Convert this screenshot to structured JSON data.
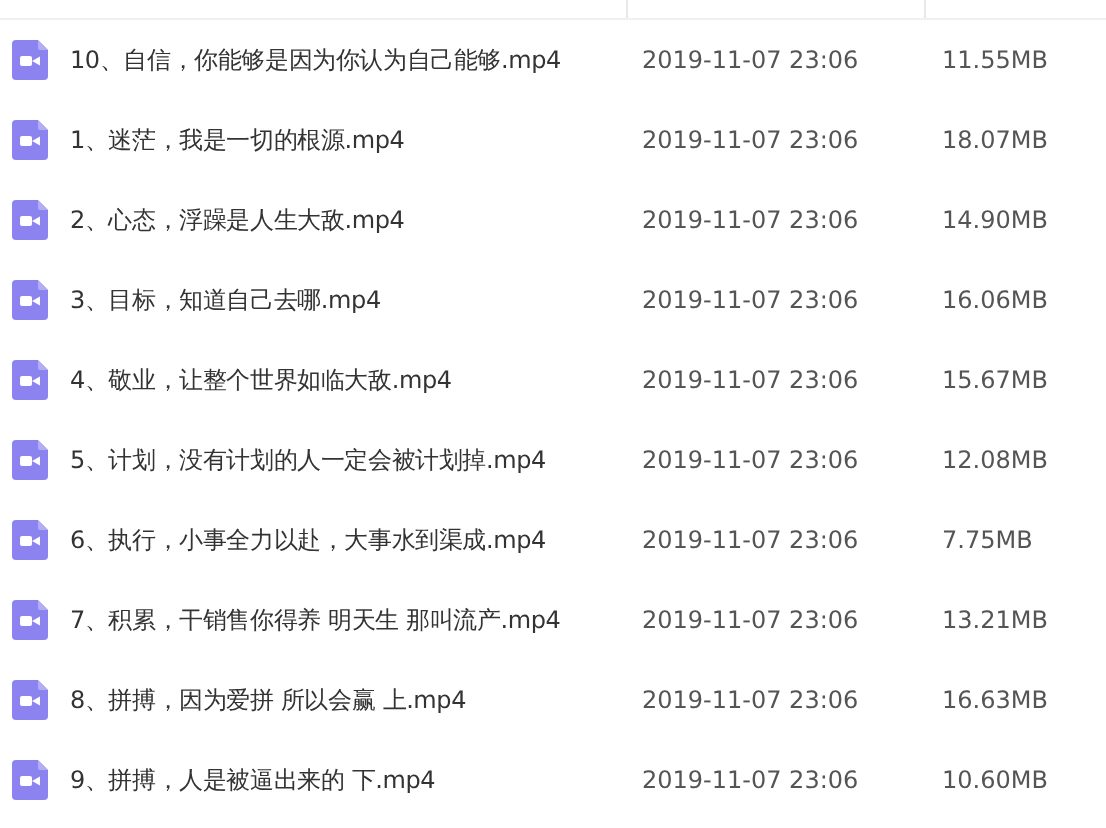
{
  "files": [
    {
      "name": "10、自信，你能够是因为你认为自己能够.mp4",
      "modified": "2019-11-07 23:06",
      "size": "11.55MB"
    },
    {
      "name": "1、迷茫，我是一切的根源.mp4",
      "modified": "2019-11-07 23:06",
      "size": "18.07MB"
    },
    {
      "name": "2、心态，浮躁是人生大敌.mp4",
      "modified": "2019-11-07 23:06",
      "size": "14.90MB"
    },
    {
      "name": "3、目标，知道自己去哪.mp4",
      "modified": "2019-11-07 23:06",
      "size": "16.06MB"
    },
    {
      "name": "4、敬业，让整个世界如临大敌.mp4",
      "modified": "2019-11-07 23:06",
      "size": "15.67MB"
    },
    {
      "name": "5、计划，没有计划的人一定会被计划掉.mp4",
      "modified": "2019-11-07 23:06",
      "size": "12.08MB"
    },
    {
      "name": "6、执行，小事全力以赴，大事水到渠成.mp4",
      "modified": "2019-11-07 23:06",
      "size": "7.75MB"
    },
    {
      "name": "7、积累，干销售你得养 明天生 那叫流产.mp4",
      "modified": "2019-11-07 23:06",
      "size": "13.21MB"
    },
    {
      "name": "8、拼搏，因为爱拼 所以会赢 上.mp4",
      "modified": "2019-11-07 23:06",
      "size": "16.63MB"
    },
    {
      "name": "9、拼搏，人是被逼出来的 下.mp4",
      "modified": "2019-11-07 23:06",
      "size": "10.60MB"
    }
  ]
}
